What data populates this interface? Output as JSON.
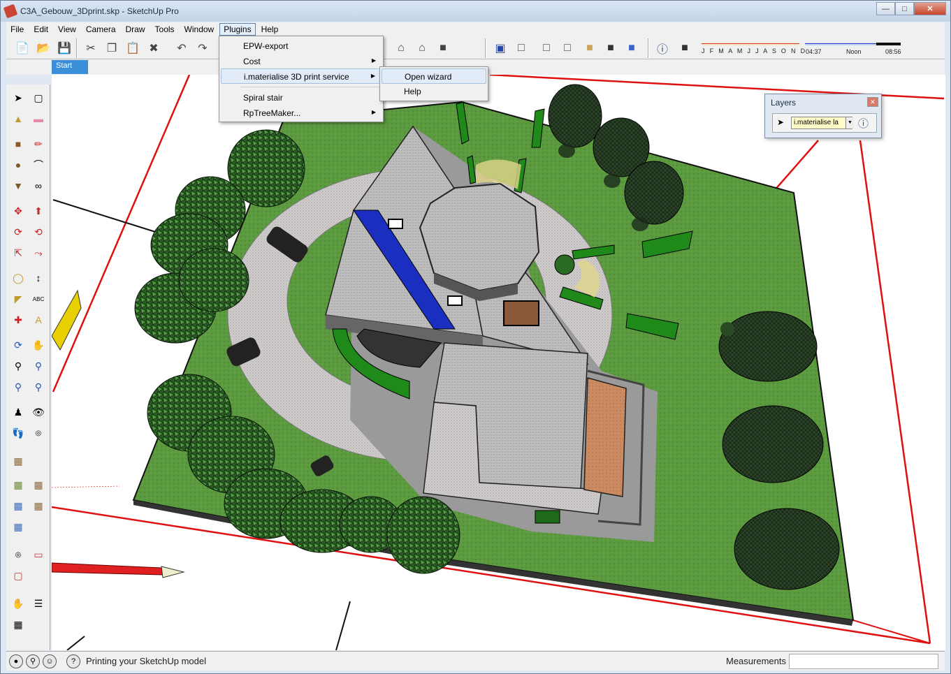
{
  "window": {
    "title": "C3A_Gebouw_3Dprint.skp - SketchUp Pro"
  },
  "menubar": {
    "items": [
      "File",
      "Edit",
      "View",
      "Camera",
      "Draw",
      "Tools",
      "Window",
      "Plugins",
      "Help"
    ],
    "open": "Plugins"
  },
  "plugins_menu": {
    "items": [
      {
        "label": "EPW-export",
        "submenu": false
      },
      {
        "label": "Cost",
        "submenu": true
      },
      {
        "label": "i.materialise 3D print service",
        "submenu": true,
        "highlighted": true
      },
      {
        "label": "Spiral stair",
        "submenu": false
      },
      {
        "label": "RpTreeMaker...",
        "submenu": true
      }
    ]
  },
  "submenu": {
    "items": [
      {
        "label": "Open wizard",
        "highlighted": true
      },
      {
        "label": "Help"
      }
    ]
  },
  "shadow_settings": {
    "months": "J F M A M J J A S O N D",
    "time_start": "04:37",
    "time_mid": "Noon",
    "time_end": "08:56"
  },
  "start_tab": "Start",
  "layers_panel": {
    "title": "Layers",
    "current_layer": "i.materialise la"
  },
  "statusbar": {
    "message": "Printing your SketchUp model",
    "measurements_label": "Measurements",
    "measurements_value": ""
  },
  "colors": {
    "grass": "#5a9640",
    "roof": "#bdbdbd",
    "tree_dark": "#1f3a1b",
    "tree_green": "#2f6d2a",
    "red_axis": "#e01010",
    "solar": "#1a2fbf"
  }
}
